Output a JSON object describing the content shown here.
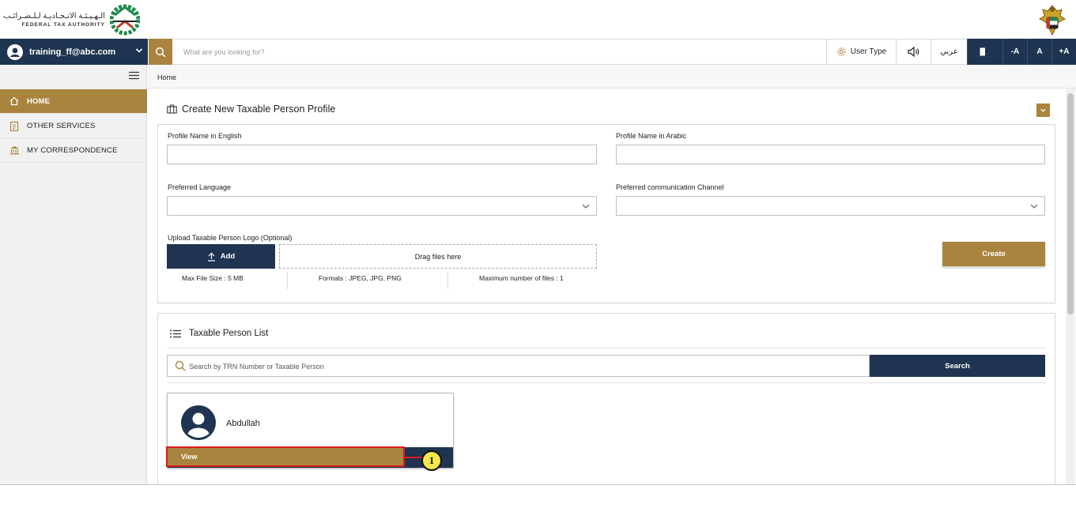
{
  "brand": {
    "name_ar": "الـهـيـئـة الاتـحـاديـة لـلـضـرائـب",
    "name_en": "FEDERAL TAX AUTHORITY"
  },
  "topnav": {
    "user_email": "training_ff@abc.com",
    "search_placeholder": "What are you looking for?",
    "user_type_label": "User Type",
    "language_toggle": "عربي",
    "font_decrease": "-A",
    "font_normal": "A",
    "font_increase": "+A"
  },
  "sidebar": {
    "items": [
      {
        "label": "HOME",
        "icon": "home-icon",
        "active": true
      },
      {
        "label": "OTHER SERVICES",
        "icon": "clipboard-icon",
        "active": false
      },
      {
        "label": "MY CORRESPONDENCE",
        "icon": "bank-icon",
        "active": false
      }
    ]
  },
  "breadcrumb": {
    "current": "Home"
  },
  "create_profile": {
    "title": "Create New Taxable Person Profile",
    "name_en_label": "Profile Name in English",
    "name_en_value": "",
    "name_ar_label": "Profile Name in Arabic",
    "name_ar_value": "",
    "language_label": "Preferred Language",
    "language_value": "",
    "channel_label": "Preferred communication Channel",
    "channel_value": "",
    "upload_label": "Upload Taxable Person Logo (Optional)",
    "add_label": "Add",
    "drop_label": "Drag files here",
    "max_size": "Max File Size : 5 MB",
    "formats": "Formats : JPEG, JPG, PNG",
    "max_files": "Maximum number of files : 1",
    "create_label": "Create"
  },
  "taxable_list": {
    "title": "Taxable Person List",
    "search_placeholder": "Search by TRN Number or Taxable Person",
    "search_label": "Search",
    "cards": [
      {
        "name": "Abdullah",
        "view_label": "View"
      }
    ]
  },
  "annotation": {
    "step": "1"
  },
  "colors": {
    "navy": "#1e3450",
    "gold": "#a8843f",
    "highlight_red": "#e01a1a",
    "callout_yellow": "#f6e84a"
  }
}
